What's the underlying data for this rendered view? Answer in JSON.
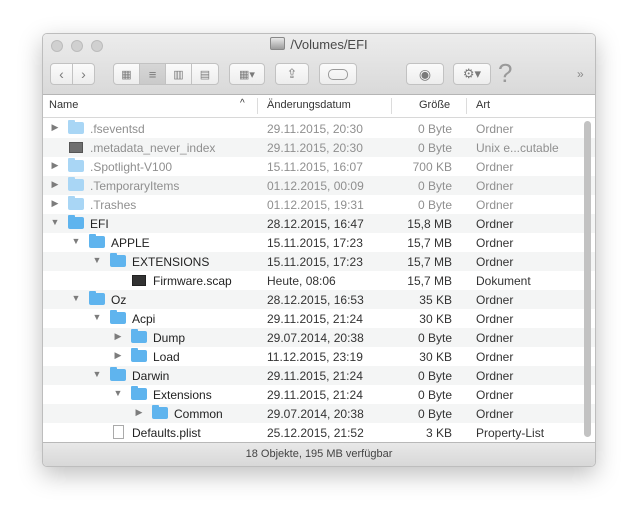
{
  "window": {
    "title": "/Volumes/EFI"
  },
  "toolbar": {
    "back_icon": "chevron-left-icon",
    "forward_icon": "chevron-right-icon",
    "help_label": "?",
    "more_label": "»"
  },
  "columns": {
    "name": "Name",
    "date": "Änderungsdatum",
    "size": "Größe",
    "kind": "Art"
  },
  "files": [
    {
      "name": ".fseventsd",
      "date": "29.11.2015, 20:30",
      "size": "0 Byte",
      "kind": "Ordner",
      "icon": "folder-icon"
    },
    {
      "name": ".metadata_never_index",
      "date": "29.11.2015, 20:30",
      "size": "0 Byte",
      "kind": "Unix e...cutable",
      "icon": "executable-icon"
    },
    {
      "name": ".Spotlight-V100",
      "date": "15.11.2015, 16:07",
      "size": "700 KB",
      "kind": "Ordner",
      "icon": "folder-icon"
    },
    {
      "name": ".TemporaryItems",
      "date": "01.12.2015, 00:09",
      "size": "0 Byte",
      "kind": "Ordner",
      "icon": "folder-icon"
    },
    {
      "name": ".Trashes",
      "date": "01.12.2015, 19:31",
      "size": "0 Byte",
      "kind": "Ordner",
      "icon": "folder-icon"
    },
    {
      "name": "EFI",
      "date": "28.12.2015, 16:47",
      "size": "15,8 MB",
      "kind": "Ordner",
      "icon": "folder-icon"
    },
    {
      "name": "APPLE",
      "date": "15.11.2015, 17:23",
      "size": "15,7 MB",
      "kind": "Ordner",
      "icon": "folder-icon"
    },
    {
      "name": "EXTENSIONS",
      "date": "15.11.2015, 17:23",
      "size": "15,7 MB",
      "kind": "Ordner",
      "icon": "folder-icon"
    },
    {
      "name": "Firmware.scap",
      "date": "Heute, 08:06",
      "size": "15,7 MB",
      "kind": "Dokument",
      "icon": "terminal-document-icon"
    },
    {
      "name": "Oz",
      "date": "28.12.2015, 16:53",
      "size": "35 KB",
      "kind": "Ordner",
      "icon": "folder-icon"
    },
    {
      "name": "Acpi",
      "date": "29.11.2015, 21:24",
      "size": "30 KB",
      "kind": "Ordner",
      "icon": "folder-icon"
    },
    {
      "name": "Dump",
      "date": "29.07.2014, 20:38",
      "size": "0 Byte",
      "kind": "Ordner",
      "icon": "folder-icon"
    },
    {
      "name": "Load",
      "date": "11.12.2015, 23:19",
      "size": "30 KB",
      "kind": "Ordner",
      "icon": "folder-icon"
    },
    {
      "name": "Darwin",
      "date": "29.11.2015, 21:24",
      "size": "0 Byte",
      "kind": "Ordner",
      "icon": "folder-icon"
    },
    {
      "name": "Extensions",
      "date": "29.11.2015, 21:24",
      "size": "0 Byte",
      "kind": "Ordner",
      "icon": "folder-icon"
    },
    {
      "name": "Common",
      "date": "29.07.2014, 20:38",
      "size": "0 Byte",
      "kind": "Ordner",
      "icon": "folder-icon"
    },
    {
      "name": "Defaults.plist",
      "date": "25.12.2015, 21:52",
      "size": "3 KB",
      "kind": "Property-List",
      "icon": "document-icon"
    }
  ],
  "status": {
    "text": "18 Objekte, 195 MB verfügbar"
  }
}
